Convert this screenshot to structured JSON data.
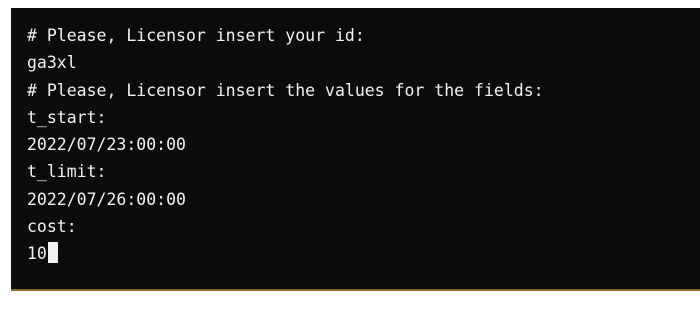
{
  "terminal": {
    "background_color": "#0c0c0c",
    "text_color": "#f2f2f2",
    "lines": [
      "# Please, Licensor insert your id:",
      "ga3xl",
      "# Please, Licensor insert the values for the fields:",
      "t_start:",
      "2022/07/23:00:00",
      "t_limit:",
      "2022/07/26:00:00",
      "cost:"
    ],
    "current_input": "10"
  }
}
